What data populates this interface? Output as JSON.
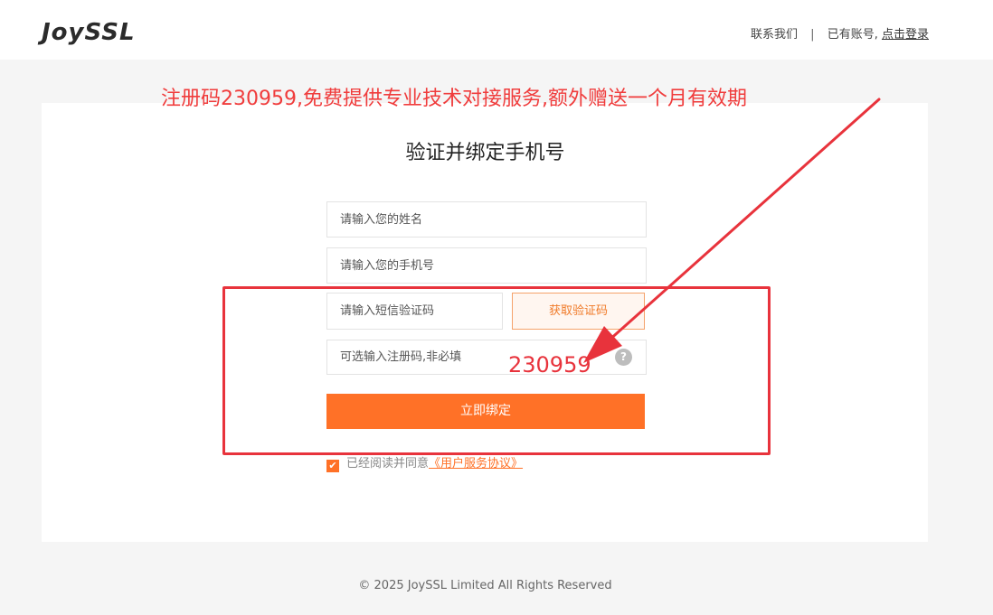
{
  "header": {
    "logo_text": "JoySSL",
    "contact_label": "联系我们",
    "separator": "|",
    "has_account_label": "已有账号,",
    "login_label": "点击登录"
  },
  "annotation": {
    "banner_text": "注册码230959,免费提供专业技术对接服务,额外赠送一个月有效期",
    "code_text": "230959",
    "color": "#e8333c"
  },
  "form": {
    "title": "验证并绑定手机号",
    "name_placeholder": "请输入您的姓名",
    "phone_placeholder": "请输入您的手机号",
    "sms_placeholder": "请输入短信验证码",
    "get_code_label": "获取验证码",
    "reg_code_placeholder": "可选输入注册码,非必填",
    "help_icon": "?",
    "submit_label": "立即绑定",
    "agree_text": "已经阅读并同意",
    "agreement_link": "《用户服务协议》",
    "checkbox_checked": true
  },
  "footer": {
    "copyright": "© 2025 JoySSL Limited All Rights Reserved"
  },
  "colors": {
    "accent": "#ff7127",
    "annotation_red": "#e8333c",
    "background": "#f5f5f5"
  },
  "icons": {
    "help": "question-circle-icon",
    "checkbox": "checkmark-icon"
  }
}
